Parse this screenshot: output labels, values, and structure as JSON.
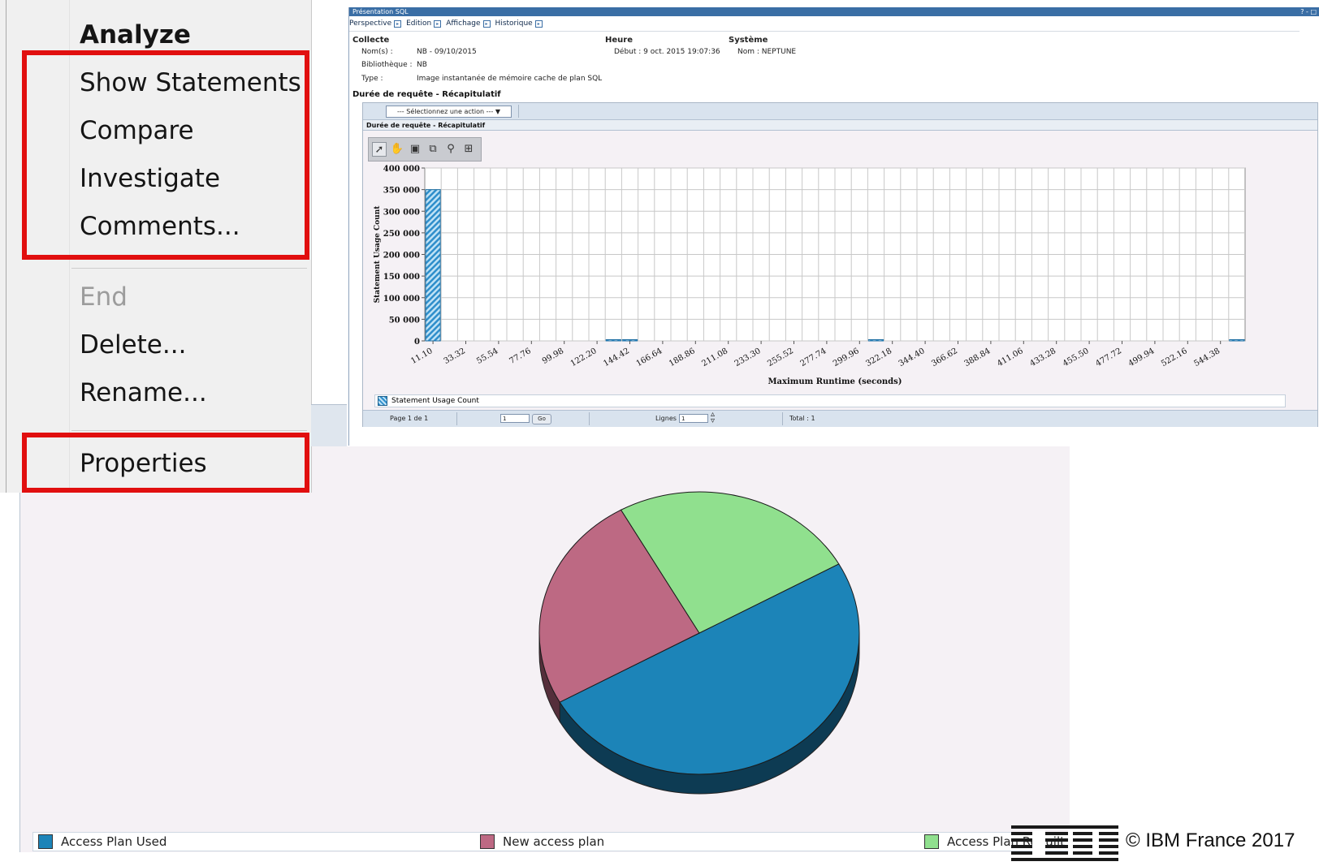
{
  "context_menu": {
    "items": [
      {
        "label": "Analyze",
        "bold": true,
        "disabled": false
      },
      {
        "label": "Show Statements",
        "bold": false,
        "disabled": false
      },
      {
        "label": "Compare",
        "bold": false,
        "disabled": false
      },
      {
        "label": "Investigate",
        "bold": false,
        "disabled": false
      },
      {
        "label": "Comments...",
        "bold": false,
        "disabled": false
      },
      {
        "label": "End",
        "bold": false,
        "disabled": true
      },
      {
        "label": "Delete...",
        "bold": false,
        "disabled": false
      },
      {
        "label": "Rename...",
        "bold": false,
        "disabled": false
      },
      {
        "label": "Properties",
        "bold": false,
        "disabled": false
      }
    ],
    "highlight_color": "#e10f0f"
  },
  "sql_window": {
    "title": "Présentation SQL",
    "title_controls": "? - □",
    "menus": [
      "Perspective",
      "Edition",
      "Affichage",
      "Historique"
    ],
    "collecte": {
      "heading": "Collecte",
      "nom_label": "Nom(s) :",
      "nom_value": "NB - 09/10/2015",
      "bibliotheque_label": "Bibliothèque :",
      "bibliotheque_value": "NB",
      "type_label": "Type :",
      "type_value": "Image instantanée de mémoire cache de plan SQL"
    },
    "heure": {
      "heading": "Heure",
      "debut": "Début : 9 oct. 2015 19:07:36"
    },
    "systeme": {
      "heading": "Système",
      "nom": "Nom : NEPTUNE"
    },
    "section_title": "Durée de requête - Récapitulatif",
    "action_select": "--- Sélectionnez une action --- ▼",
    "inner_title": "Durée de requête - Récapitulatif",
    "toolbar_icons": [
      "pointer-icon",
      "hand-icon",
      "tooltip-icon",
      "zoom-box-icon",
      "zoom-out-icon",
      "fit-icon"
    ],
    "pager": {
      "page": "Page 1 de 1",
      "page_input": "1",
      "go": "Go",
      "lignes_label": "Lignes",
      "lignes_input": "1",
      "total": "Total : 1"
    }
  },
  "chart_data": [
    {
      "type": "bar",
      "title": "",
      "xlabel": "Maximum Runtime (seconds)",
      "ylabel": "Statement Usage Count",
      "ylim": [
        0,
        400000
      ],
      "yticks": [
        "0",
        "50 000",
        "100 000",
        "150 000",
        "200 000",
        "250 000",
        "300 000",
        "350 000",
        "400 000"
      ],
      "categories": [
        "11.10",
        "33.32",
        "55.54",
        "77.76",
        "99.98",
        "122.20",
        "144.42",
        "166.64",
        "188.86",
        "211.08",
        "233.30",
        "255.52",
        "277.74",
        "299.96",
        "322.18",
        "344.40",
        "366.62",
        "388.84",
        "411.06",
        "433.28",
        "455.50",
        "477.72",
        "499.94",
        "522.16",
        "544.38"
      ],
      "fine_bins": 50,
      "series": [
        {
          "name": "Statement Usage Count",
          "bars": [
            {
              "bin": 0,
              "value": 350000
            },
            {
              "bin": 11,
              "value": 1500
            },
            {
              "bin": 12,
              "value": 1500
            },
            {
              "bin": 27,
              "value": 1200
            },
            {
              "bin": 49,
              "value": 1200
            }
          ]
        }
      ],
      "grid": true,
      "legend": "bottom"
    },
    {
      "type": "pie",
      "slices": [
        {
          "label": "Access Plan Used",
          "value": 50,
          "color": "#1c84b8"
        },
        {
          "label": "New access plan",
          "value": 25,
          "color": "#bd6983"
        },
        {
          "label": "Access Plan Rebuilt",
          "value": 25,
          "color": "#90e08e"
        }
      ],
      "legend": "bottom"
    }
  ],
  "footer": {
    "logo_name": "ibm-logo",
    "copyright": "© IBM France 2017"
  }
}
